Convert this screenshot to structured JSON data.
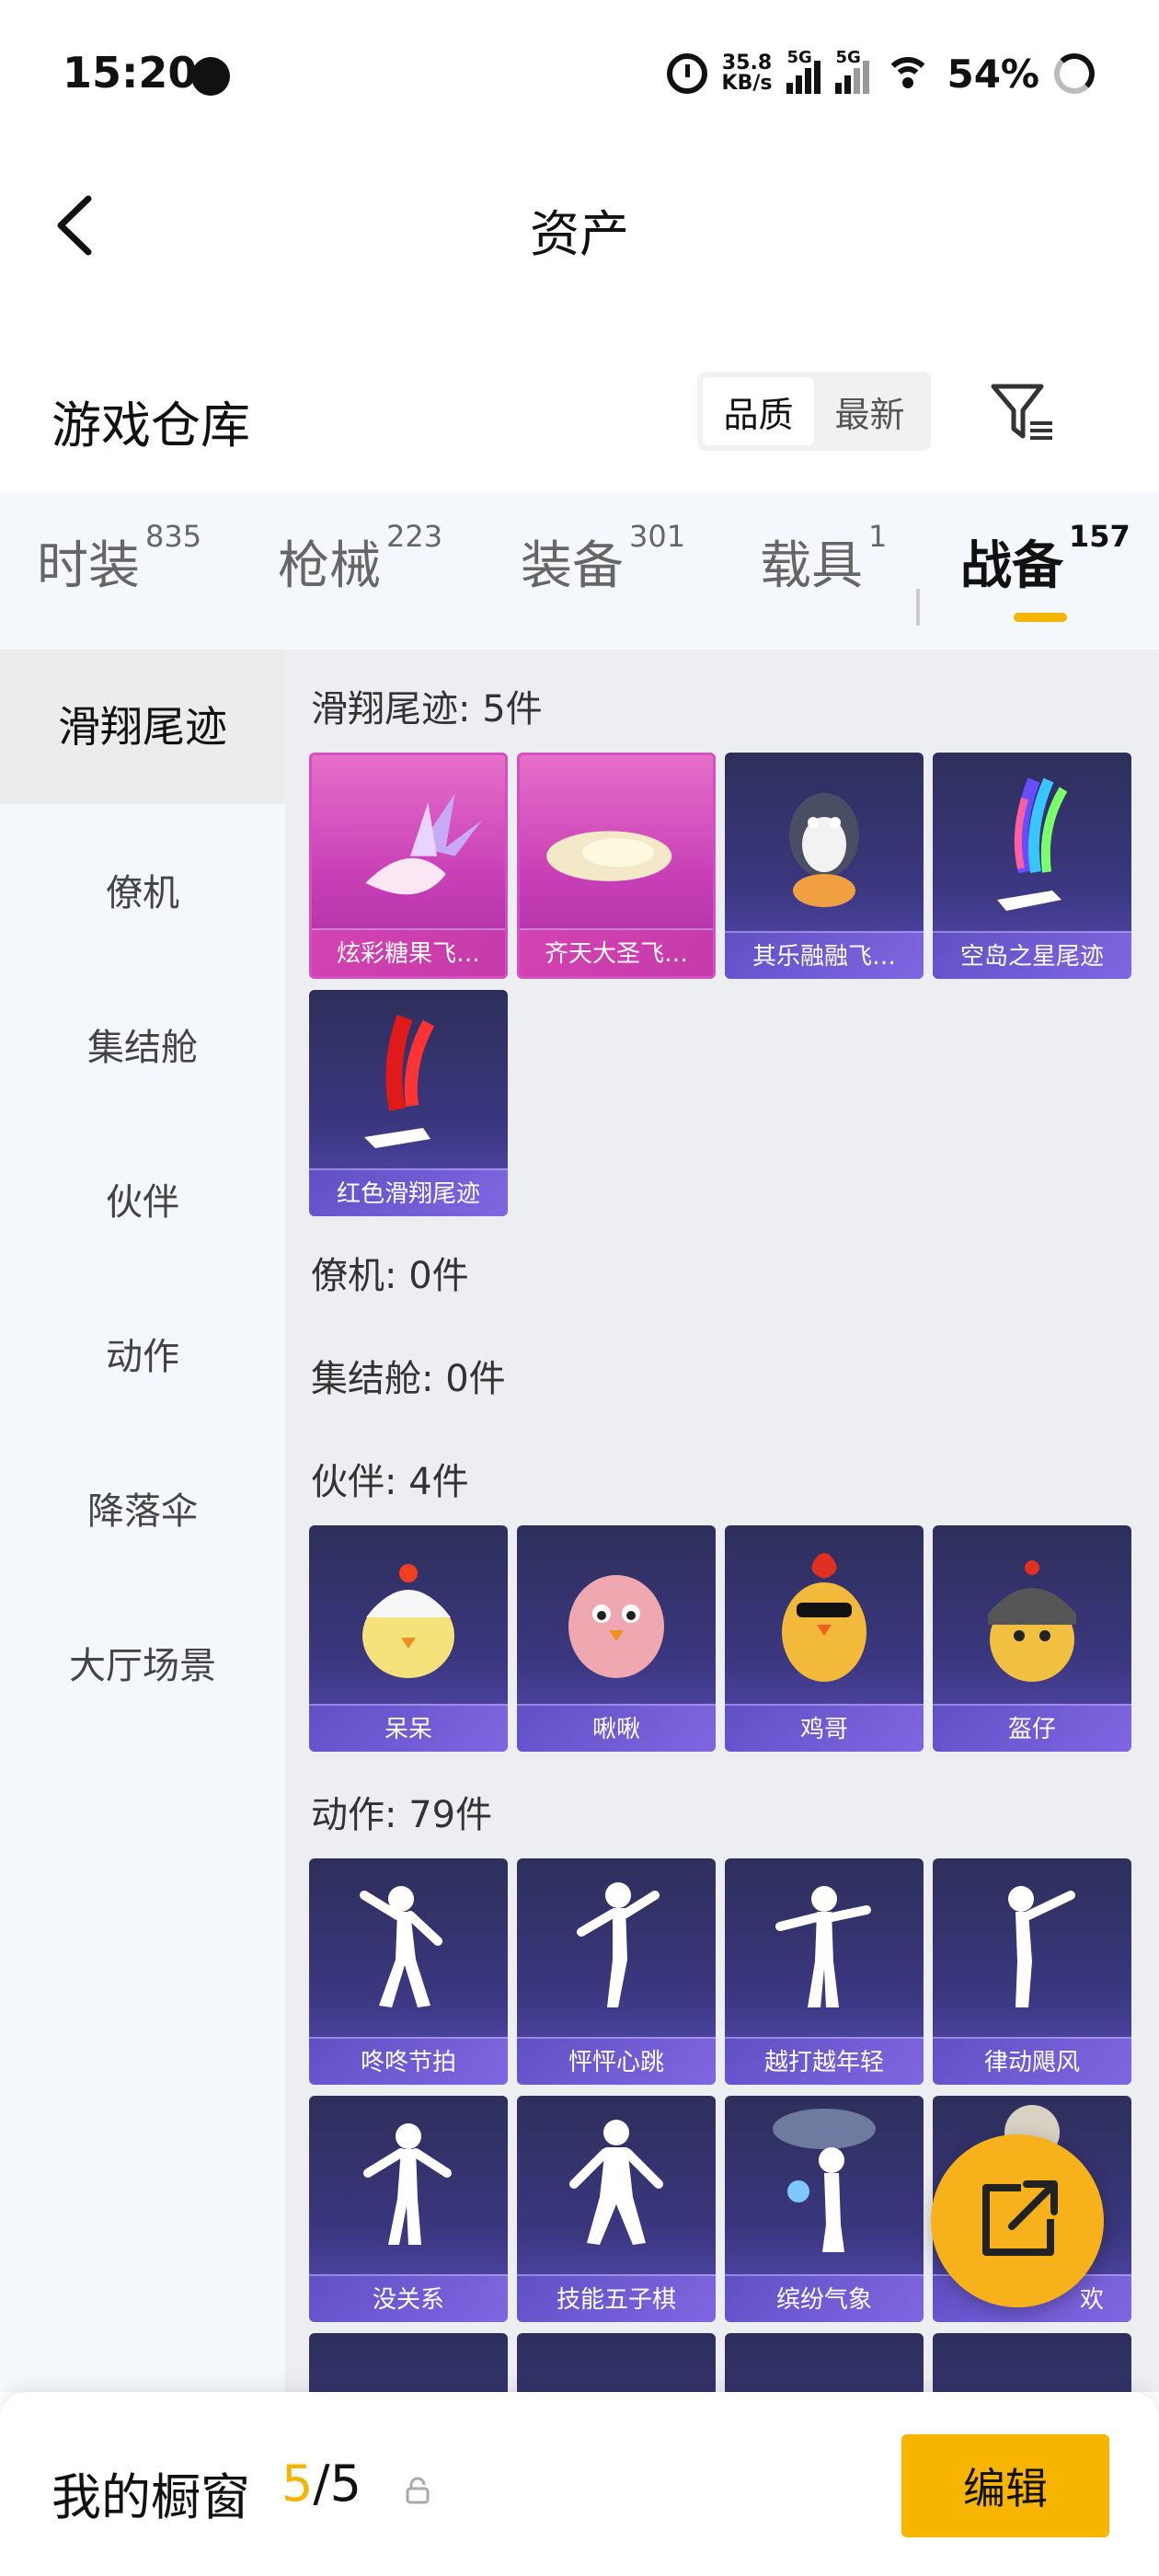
{
  "status_bar": {
    "time": "15:20",
    "net_speed_value": "35.8",
    "net_speed_unit": "KB/s",
    "sim1": "5G",
    "sim2": "5G",
    "battery": "54%"
  },
  "header": {
    "title": "资产"
  },
  "warehouse": {
    "title": "游戏仓库",
    "sort_options": [
      "品质",
      "最新"
    ],
    "active_sort": "品质"
  },
  "tabs": [
    {
      "label": "时装",
      "count": "835"
    },
    {
      "label": "枪械",
      "count": "223"
    },
    {
      "label": "装备",
      "count": "301"
    },
    {
      "label": "载具",
      "count": "1"
    },
    {
      "label": "战备",
      "count": "157",
      "active": true
    }
  ],
  "sidebar": {
    "items": [
      "滑翔尾迹",
      "僚机",
      "集结舱",
      "伙伴",
      "动作",
      "降落伞",
      "大厅场景"
    ],
    "active": "滑翔尾迹"
  },
  "sections": {
    "trail": {
      "title": "滑翔尾迹: 5件",
      "items": [
        "炫彩糖果飞…",
        "齐天大圣飞…",
        "其乐融融飞…",
        "空岛之星尾迹",
        "红色滑翔尾迹"
      ]
    },
    "wingman": {
      "title": "僚机: 0件"
    },
    "pod": {
      "title": "集结舱: 0件"
    },
    "companion": {
      "title": "伙伴: 4件",
      "items": [
        "呆呆",
        "啾啾",
        "鸡哥",
        "盔仔"
      ]
    },
    "emote": {
      "title": "动作: 79件",
      "items": [
        "咚咚节拍",
        "怦怦心跳",
        "越打越年轻",
        "律动飓风",
        "没关系",
        "技能五子棋",
        "缤纷气象",
        "欢"
      ]
    }
  },
  "showcase": {
    "label": "我的橱窗",
    "current": "5",
    "separator": "/",
    "total": "5",
    "edit_label": "编辑"
  },
  "colors": {
    "accent": "#f5b400",
    "card_purple": "#3b3780",
    "card_pink": "#c83fb6"
  }
}
